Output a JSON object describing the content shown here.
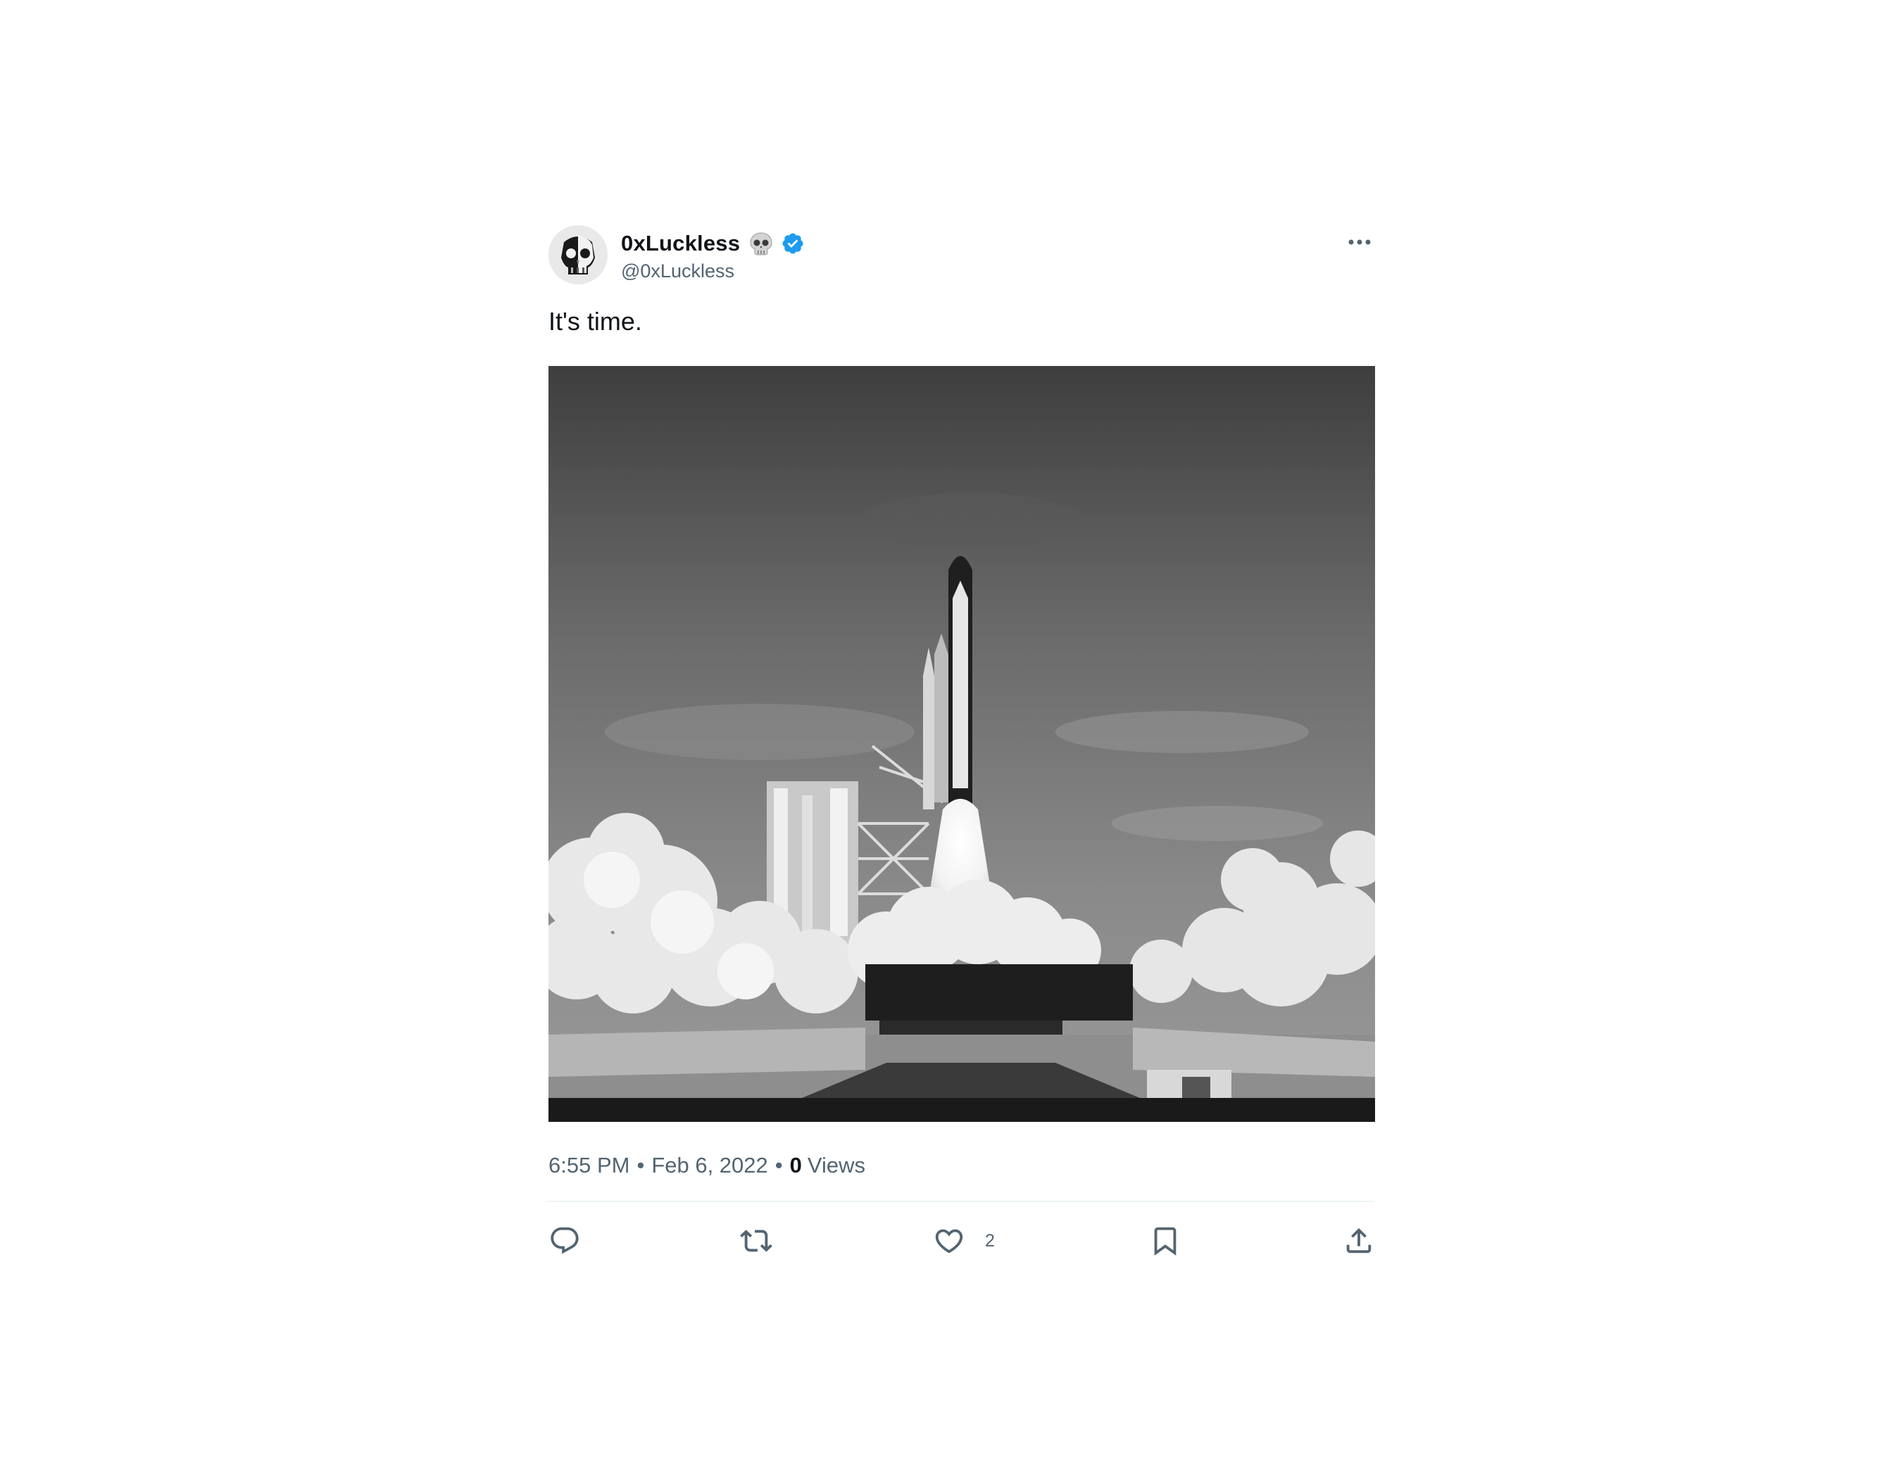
{
  "tweet": {
    "display_name": "0xLuckless",
    "handle": "@0xLuckless",
    "text": "It's time.",
    "time": "6:55 PM",
    "separator": "•",
    "date": "Feb 6, 2022",
    "views_count": "0",
    "views_label": "Views",
    "likes_count": "2"
  },
  "icons": {
    "avatar": "skull-avatar",
    "name_emoji": "skull-icon",
    "verified": "verified-badge-icon",
    "more": "more-options-icon",
    "reply": "reply-icon",
    "retweet": "retweet-icon",
    "like": "heart-icon",
    "bookmark": "bookmark-icon",
    "share": "share-icon"
  },
  "colors": {
    "verified_blue": "#1d9bf0",
    "text_primary": "#0f1419",
    "text_secondary": "#536471",
    "divider": "#eff3f4"
  }
}
